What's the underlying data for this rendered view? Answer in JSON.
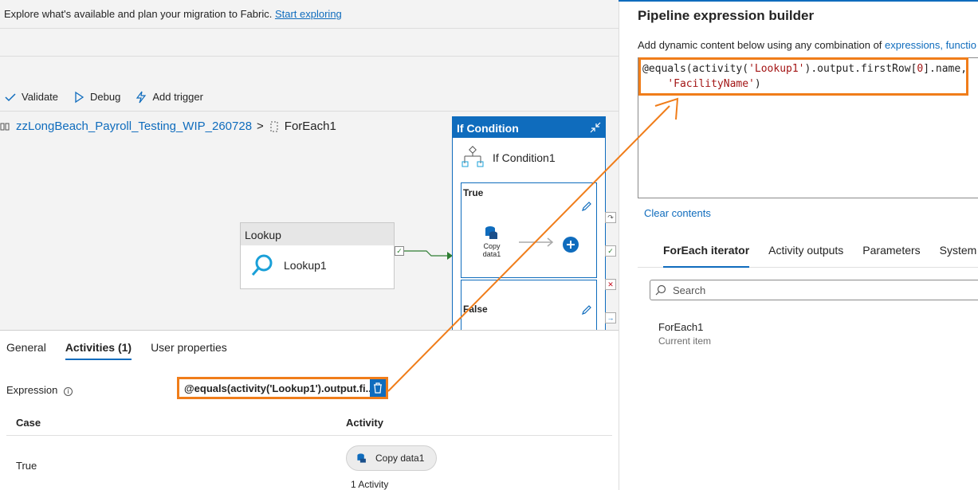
{
  "banner": {
    "text": "Explore what's available and plan your migration to Fabric.",
    "link": "Start exploring"
  },
  "toolbar": {
    "validate": "Validate",
    "debug": "Debug",
    "add_trigger": "Add trigger"
  },
  "breadcrumb": {
    "pipeline": "zzLongBeach_Payroll_Testing_WIP_260728",
    "sep": ">",
    "current": "ForEach1"
  },
  "canvas": {
    "lookup_header": "Lookup",
    "lookup_name": "Lookup1",
    "if_header": "If Condition",
    "if_name": "If Condition1",
    "true_label": "True",
    "copy_label_1": "Copy",
    "copy_label_2": "data1",
    "false_label": "False"
  },
  "bottom": {
    "tabs": [
      "General",
      "Activities (1)",
      "User properties"
    ],
    "expression_label": "Expression",
    "expression_value": "@equals(activity('Lookup1').output.fi...",
    "col_case": "Case",
    "col_activity": "Activity",
    "row_case": "True",
    "row_activity": "Copy data1",
    "activity_count": "1 Activity"
  },
  "builder": {
    "title": "Pipeline expression builder",
    "subtitle": "Add dynamic content below using any combination of",
    "subtitle_link": "expressions, functio",
    "code_line1_a": "@equals(activity(",
    "code_line1_b": "'Lookup1'",
    "code_line1_c": ").output.firstRow[",
    "code_line1_d": "0",
    "code_line1_e": "].name,",
    "code_line2": "'FacilityName'",
    "code_line2_end": ")",
    "clear": "Clear contents",
    "tabs": [
      "ForEach iterator",
      "Activity outputs",
      "Parameters",
      "System va"
    ],
    "search_placeholder": "Search",
    "item_title": "ForEach1",
    "item_sub": "Current item"
  },
  "colors": {
    "accent": "#0f6cbd",
    "highlight": "#f07d1a",
    "success": "#2e7d32",
    "error": "#c50f1f"
  }
}
